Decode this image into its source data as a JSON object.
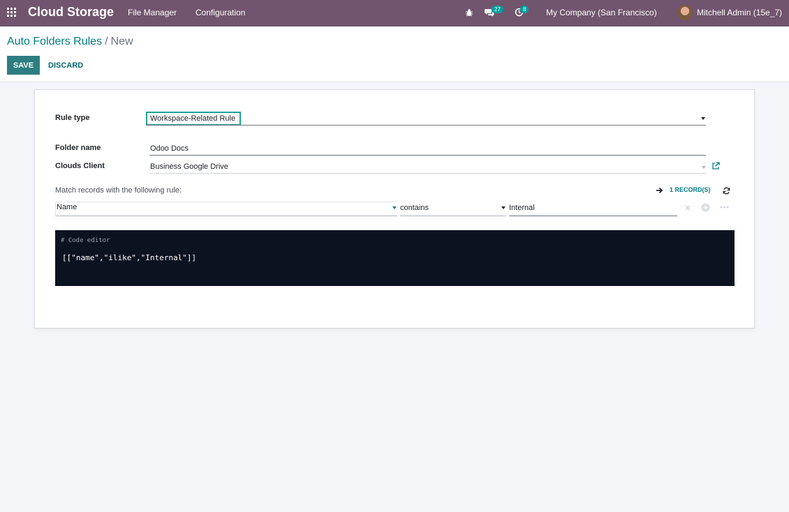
{
  "navbar": {
    "brand": "Cloud Storage",
    "menus": [
      "File Manager",
      "Configuration"
    ],
    "messages_count": "27",
    "activities_count": "8",
    "company": "My Company (San Francisco)",
    "user": "Mitchell Admin (15e_7)"
  },
  "breadcrumb": {
    "parent": "Auto Folders Rules",
    "separator": "/",
    "current": "New"
  },
  "buttons": {
    "save": "SAVE",
    "discard": "DISCARD"
  },
  "form": {
    "rule_type_label": "Rule type",
    "rule_type_value": "Workspace-Related Rule",
    "folder_name_label": "Folder name",
    "folder_name_value": "Odoo Docs",
    "clouds_client_label": "Clouds Client",
    "clouds_client_value": "Business Google Drive",
    "domain_label": "Match records with the following rule:",
    "records_count": "1 RECORD(S)",
    "domain_field": "Name",
    "domain_operator": "contains",
    "domain_value": "Internal",
    "code_comment": "# Code editor",
    "code_value": "[[\"name\",\"ilike\",\"Internal\"]]"
  },
  "colors": {
    "navbar": "#71546d",
    "primary": "#2d7e80",
    "link": "#017e84",
    "focus": "#1ba393",
    "code_bg": "#0b1220"
  }
}
